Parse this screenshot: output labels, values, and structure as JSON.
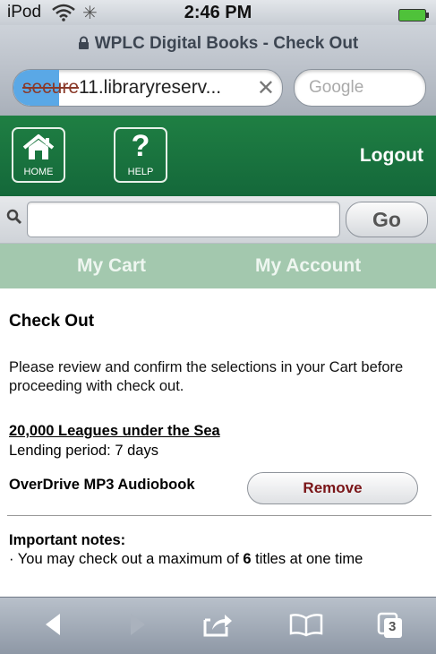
{
  "status": {
    "carrier": "iPod",
    "time": "2:46 PM"
  },
  "browser": {
    "page_title": "WPLC Digital Books - Check Out",
    "url_prefix": "secure",
    "url_rest": "11.libraryreserv...",
    "url_clear": "✕",
    "search_placeholder": "Google",
    "load_progress_percent": 17
  },
  "header": {
    "home_label": "HOME",
    "help_label": "HELP",
    "help_glyph": "?",
    "logout": "Logout"
  },
  "site_search": {
    "value": "",
    "go": "Go"
  },
  "tabs": [
    {
      "label": "My Cart"
    },
    {
      "label": "My Account"
    }
  ],
  "content": {
    "title": "Check Out",
    "intro": "Please review and confirm the selections in your Cart before proceeding with check out.",
    "item": {
      "title": "20,000 Leagues under the Sea",
      "lending": "Lending period: 7 days",
      "format": "OverDrive MP3 Audiobook",
      "remove": "Remove"
    },
    "notes_title": "Important notes:",
    "note_prefix": "· You may check out a maximum of ",
    "note_number": "6",
    "note_suffix": " titles at one time"
  },
  "toolbar": {
    "tabs_count": "3"
  },
  "colors": {
    "header_green": "#1f7f43",
    "tab_bar": "#a3c8ae",
    "remove_text": "#7a1518"
  }
}
